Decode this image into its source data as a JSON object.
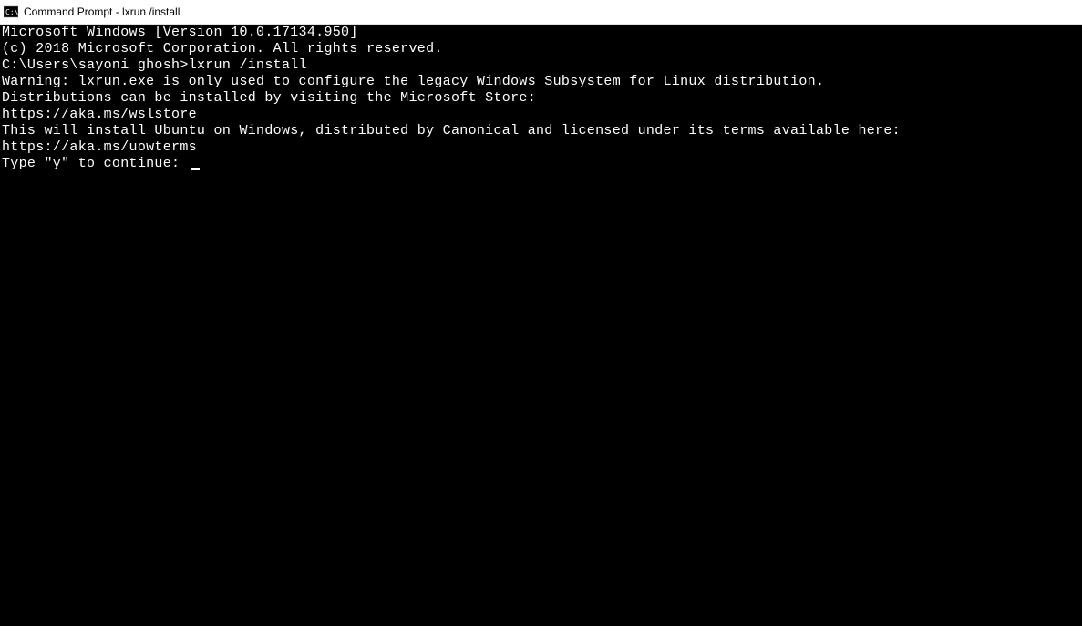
{
  "titlebar": {
    "title": "Command Prompt - lxrun  /install"
  },
  "terminal": {
    "line1": "Microsoft Windows [Version 10.0.17134.950]",
    "line2": "(c) 2018 Microsoft Corporation. All rights reserved.",
    "blank1": "",
    "prompt": "C:\\Users\\sayoni ghosh>",
    "command": "lxrun /install",
    "line3": "Warning: lxrun.exe is only used to configure the legacy Windows Subsystem for Linux distribution.",
    "line4": "Distributions can be installed by visiting the Microsoft Store:",
    "line5": "https://aka.ms/wslstore",
    "blank2": "",
    "line6": "This will install Ubuntu on Windows, distributed by Canonical and licensed under its terms available here:",
    "line7": "https://aka.ms/uowterms",
    "blank3": "",
    "line8": "Type \"y\" to continue: "
  }
}
